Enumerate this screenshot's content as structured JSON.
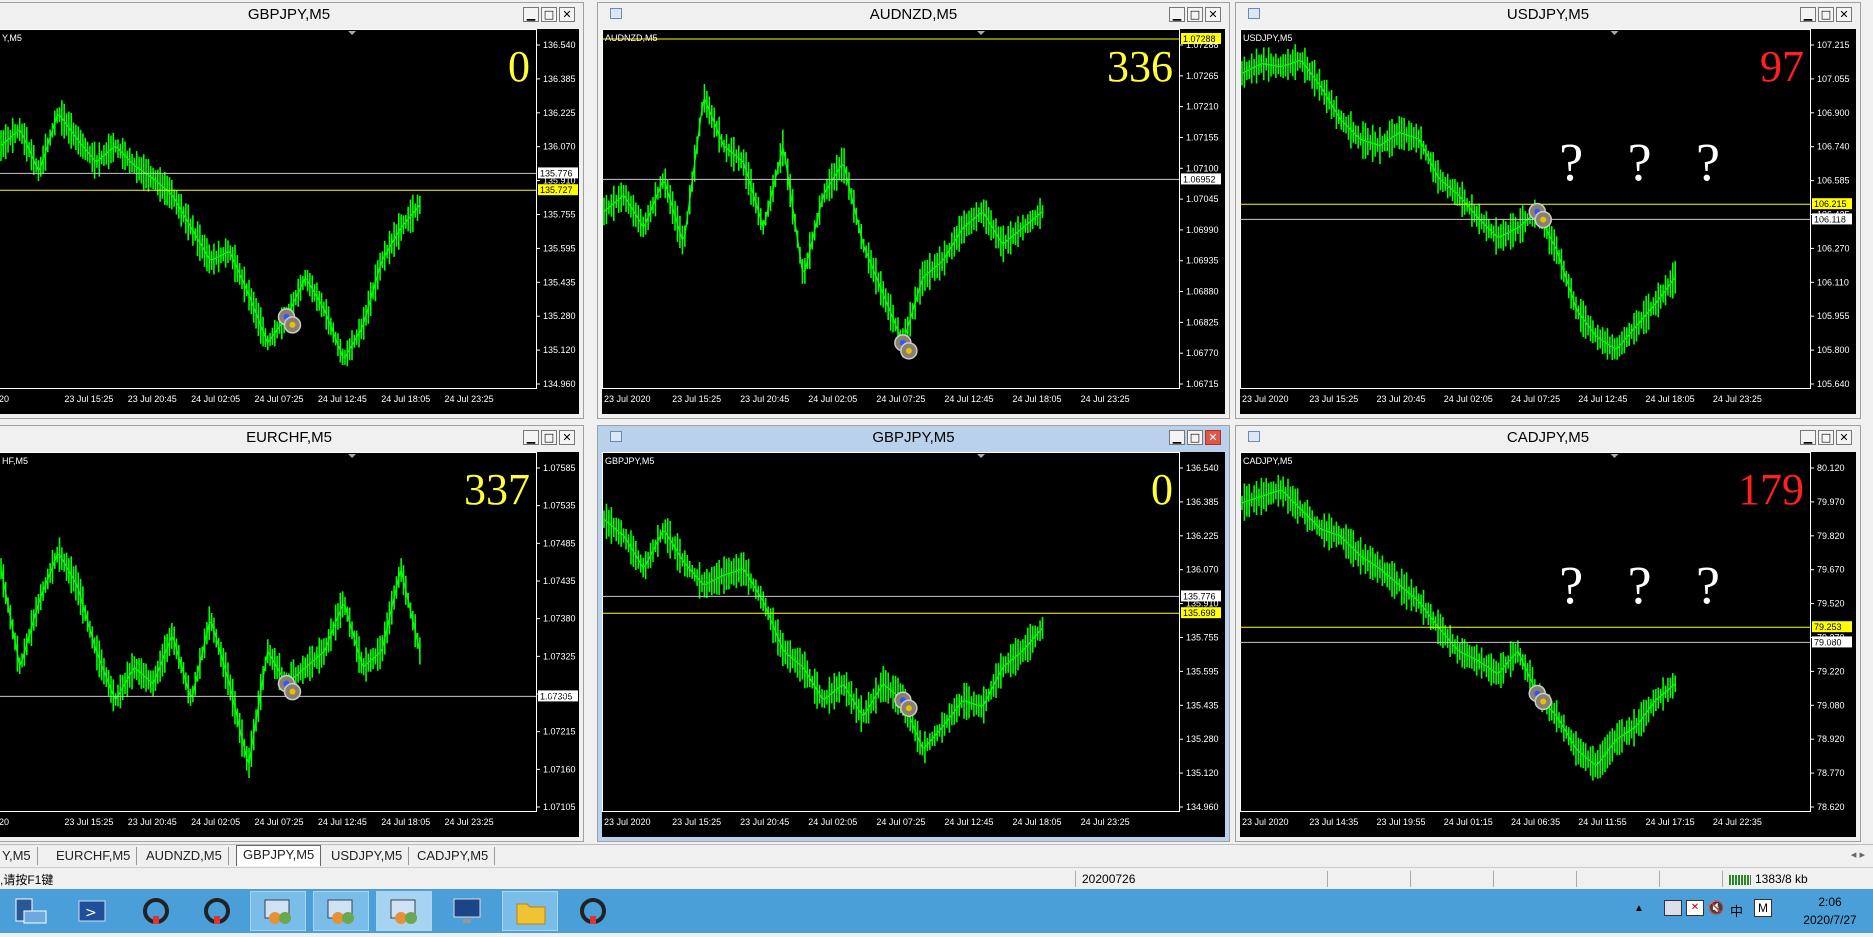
{
  "windows": [
    {
      "title": "GBPJPY,M5",
      "label": "Y,M5",
      "counter": "0",
      "counter_color": "#ffff33",
      "price_ticks": [
        "136.540",
        "136.385",
        "136.225",
        "136.070",
        "135.910",
        "135.755",
        "135.595",
        "135.435",
        "135.280",
        "135.120",
        "134.960"
      ],
      "hline_tags": [
        {
          "text": "135.776",
          "yellow": false
        },
        {
          "text": "135.727",
          "yellow": true
        }
      ],
      "time_labels": [
        "20",
        "23 Jul 15:25",
        "23 Jul 20:45",
        "24 Jul 02:05",
        "24 Jul 07:25",
        "24 Jul 12:45",
        "24 Jul 18:05",
        "24 Jul 23:25"
      ],
      "questions": false
    },
    {
      "title": "AUDNZD,M5",
      "label": "AUDNZD,M5",
      "counter": "336",
      "counter_color": "#ffff33",
      "price_ticks": [
        "1.07288",
        "1.07265",
        "1.07210",
        "1.07155",
        "1.07100",
        "1.07045",
        "1.06990",
        "1.06935",
        "1.06880",
        "1.06825",
        "1.06770",
        "1.06715"
      ],
      "hline_tags": [
        {
          "text": "1.07288",
          "yellow": true
        },
        {
          "text": "1.06952",
          "yellow": false
        }
      ],
      "time_labels": [
        "23 Jul 2020",
        "23 Jul 15:25",
        "23 Jul 20:45",
        "24 Jul 02:05",
        "24 Jul 07:25",
        "24 Jul 12:45",
        "24 Jul 18:05",
        "24 Jul 23:25"
      ],
      "questions": false
    },
    {
      "title": "USDJPY,M5",
      "label": "USDJPY,M5",
      "counter": "97",
      "counter_color": "#ff2020",
      "price_ticks": [
        "107.215",
        "107.055",
        "106.900",
        "106.740",
        "106.585",
        "106.425",
        "106.270",
        "106.110",
        "105.955",
        "105.800",
        "105.640"
      ],
      "hline_tags": [
        {
          "text": "106.215",
          "yellow": true
        },
        {
          "text": "106.118",
          "yellow": false
        }
      ],
      "time_labels": [
        "23 Jul 2020",
        "23 Jul 15:25",
        "23 Jul 20:45",
        "24 Jul 02:05",
        "24 Jul 07:25",
        "24 Jul 12:45",
        "24 Jul 18:05",
        "24 Jul 23:25"
      ],
      "questions": true
    },
    {
      "title": "EURCHF,M5",
      "label": "HF,M5",
      "counter": "337",
      "counter_color": "#ffff33",
      "price_ticks": [
        "1.07585",
        "1.07535",
        "1.07485",
        "1.07435",
        "1.07380",
        "1.07325",
        "1.07270",
        "1.07215",
        "1.07160",
        "1.07105"
      ],
      "hline_tags": [
        {
          "text": "1.07305",
          "yellow": false
        }
      ],
      "time_labels": [
        "20",
        "23 Jul 15:25",
        "23 Jul 20:45",
        "24 Jul 02:05",
        "24 Jul 07:25",
        "24 Jul 12:45",
        "24 Jul 18:05",
        "24 Jul 23:25"
      ],
      "questions": false
    },
    {
      "title": "GBPJPY,M5",
      "label": "GBPJPY,M5",
      "counter": "0",
      "counter_color": "#ffff33",
      "price_ticks": [
        "136.540",
        "136.385",
        "136.225",
        "136.070",
        "135.910",
        "135.755",
        "135.595",
        "135.435",
        "135.280",
        "135.120",
        "134.960"
      ],
      "hline_tags": [
        {
          "text": "135.776",
          "yellow": false
        },
        {
          "text": "135.698",
          "yellow": true
        }
      ],
      "time_labels": [
        "23 Jul 2020",
        "23 Jul 15:25",
        "23 Jul 20:45",
        "24 Jul 02:05",
        "24 Jul 07:25",
        "24 Jul 12:45",
        "24 Jul 18:05",
        "24 Jul 23:25"
      ],
      "questions": false
    },
    {
      "title": "CADJPY,M5",
      "label": "CADJPY,M5",
      "counter": "179",
      "counter_color": "#ff2020",
      "price_ticks": [
        "80.120",
        "79.970",
        "79.820",
        "79.670",
        "79.520",
        "79.370",
        "79.220",
        "79.080",
        "78.920",
        "78.770",
        "78.620"
      ],
      "hline_tags": [
        {
          "text": "79.253",
          "yellow": true
        },
        {
          "text": "79.080",
          "yellow": false
        }
      ],
      "time_labels": [
        "23 Jul 2020",
        "23 Jul 14:35",
        "23 Jul 19:55",
        "24 Jul 01:15",
        "24 Jul 06:35",
        "24 Jul 11:55",
        "24 Jul 17:15",
        "24 Jul 22:35"
      ],
      "questions": true
    }
  ],
  "question_mark": "?",
  "tabs": [
    "Y,M5",
    "EURCHF,M5",
    "AUDNZD,M5",
    "GBPJPY,M5",
    "USDJPY,M5",
    "CADJPY,M5"
  ],
  "selected_tab": 3,
  "status": {
    "help": "请按F1键",
    "left_prefix": ",",
    "date": "20200726",
    "traffic": "1383/8 kb"
  },
  "clock": {
    "time": "2:06",
    "date": "2020/7/27"
  },
  "taskbar_icons": [
    "server-manager-icon",
    "powershell-icon",
    "terminal-icon",
    "terminal-icon",
    "remote-desktop-icon",
    "remote-desktop-icon",
    "remote-desktop-icon",
    "monitor-icon",
    "folder-icon",
    "terminal-icon"
  ],
  "colors": {
    "candles": "#00ff00",
    "hline_white": "#c8c8c8",
    "hline_yellow": "#ffff00",
    "question": "#ffffff"
  }
}
